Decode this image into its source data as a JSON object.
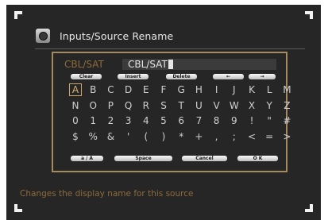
{
  "header": {
    "title": "Inputs/Source Rename",
    "icon": "input-source-icon"
  },
  "editor": {
    "current_name": "CBL/SAT",
    "field_value": "CBL/SAT"
  },
  "buttons": {
    "top": [
      "Clear",
      "Insert",
      "Delete",
      "←",
      "→"
    ],
    "bottom": [
      "a / A",
      "Space",
      "Cancel",
      "O K"
    ]
  },
  "keyboard": {
    "rows": [
      [
        "A",
        "B",
        "C",
        "D",
        "E",
        "F",
        "G",
        "H",
        "I",
        "J",
        "K",
        "L",
        "M"
      ],
      [
        "N",
        "O",
        "P",
        "Q",
        "R",
        "S",
        "T",
        "U",
        "V",
        "W",
        "X",
        "Y",
        "Z"
      ],
      [
        "0",
        "1",
        "2",
        "3",
        "4",
        "5",
        "6",
        "7",
        "8",
        "9",
        "!",
        "\"",
        "#"
      ],
      [
        "$",
        "%",
        "&",
        "'",
        "(",
        ")",
        "*",
        "+",
        ",",
        ";",
        "<",
        "=",
        ">"
      ]
    ],
    "selected": "A"
  },
  "description": "Changes the display name for this source",
  "colors": {
    "background": "#262626",
    "panel_border": "#a58a5e",
    "accent_text": "#8d6b3a",
    "text": "#e8e8e8"
  }
}
